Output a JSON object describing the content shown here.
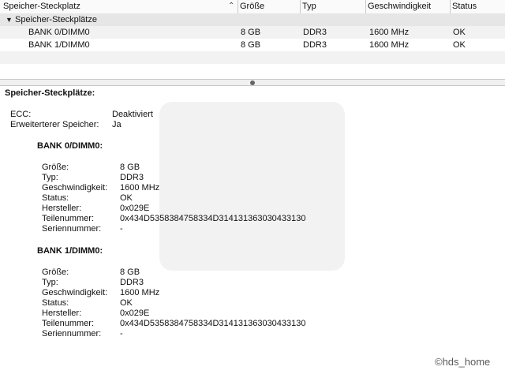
{
  "header": {
    "columns": [
      "Speicher-Steckplatz",
      "Größe",
      "Typ",
      "Geschwindigkeit",
      "Status"
    ]
  },
  "list": {
    "group_label": "Speicher-Steckplätze",
    "rows": [
      {
        "slot": "BANK 0/DIMM0",
        "size": "8 GB",
        "type": "DDR3",
        "speed": "1600 MHz",
        "status": "OK"
      },
      {
        "slot": "BANK 1/DIMM0",
        "size": "8 GB",
        "type": "DDR3",
        "speed": "1600 MHz",
        "status": "OK"
      }
    ]
  },
  "detail": {
    "title": "Speicher-Steckplätze:",
    "ecc_label": "ECC:",
    "ecc_value": "Deaktiviert",
    "ext_label": "Erweiterterer Speicher:",
    "ext_value": "Ja",
    "field_labels": [
      "Größe:",
      "Typ:",
      "Geschwindigkeit:",
      "Status:",
      "Hersteller:",
      "Teilenummer:",
      "Seriennummer:"
    ],
    "banks": [
      {
        "title": "BANK 0/DIMM0:",
        "values": [
          "8 GB",
          "DDR3",
          "1600 MHz",
          "OK",
          "0x029E",
          "0x434D5358384758334D314131363030433130",
          "-"
        ]
      },
      {
        "title": "BANK 1/DIMM0:",
        "values": [
          "8 GB",
          "DDR3",
          "1600 MHz",
          "OK",
          "0x029E",
          "0x434D5358384758334D314131363030433130",
          "-"
        ]
      }
    ]
  },
  "watermark": "©hds_home",
  "icons": {
    "sort": "chevron-up-icon",
    "disclosure": "triangle-down-icon",
    "splitter": "grip-dot-icon"
  }
}
